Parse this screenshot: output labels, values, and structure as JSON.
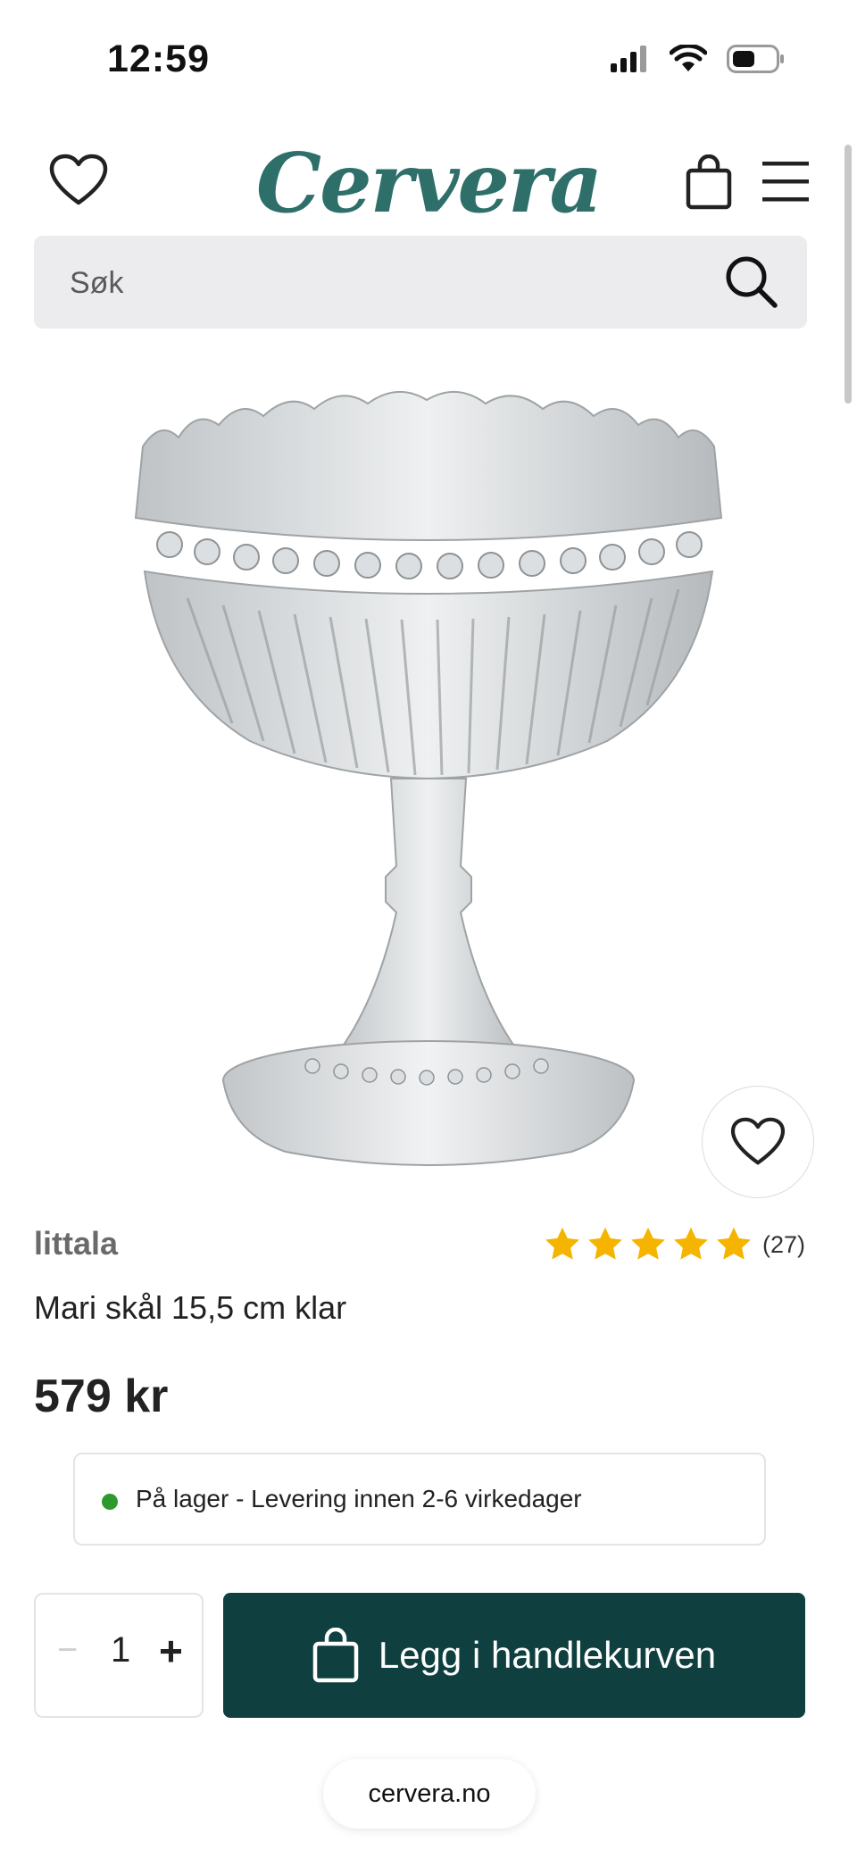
{
  "status_bar": {
    "time": "12:59"
  },
  "header": {
    "logo": "Cervera"
  },
  "search": {
    "placeholder": "Søk"
  },
  "product": {
    "brand": "littala",
    "rating_count": "(27)",
    "rating_stars": 5,
    "title": "Mari skål 15,5 cm klar",
    "price": "579 kr",
    "stock_text": "På lager - Levering innen 2-6 virkedager"
  },
  "purchase": {
    "qty_minus": "−",
    "quantity": "1",
    "qty_plus": "+",
    "add_to_cart": "Legg i handlekurven"
  },
  "browser": {
    "url": "cervera.no"
  },
  "colors": {
    "brand_teal": "#2f6f6a",
    "cta_dark_teal": "#0f3f3e",
    "star_gold": "#f5b400",
    "stock_green": "#2e9a2e"
  }
}
